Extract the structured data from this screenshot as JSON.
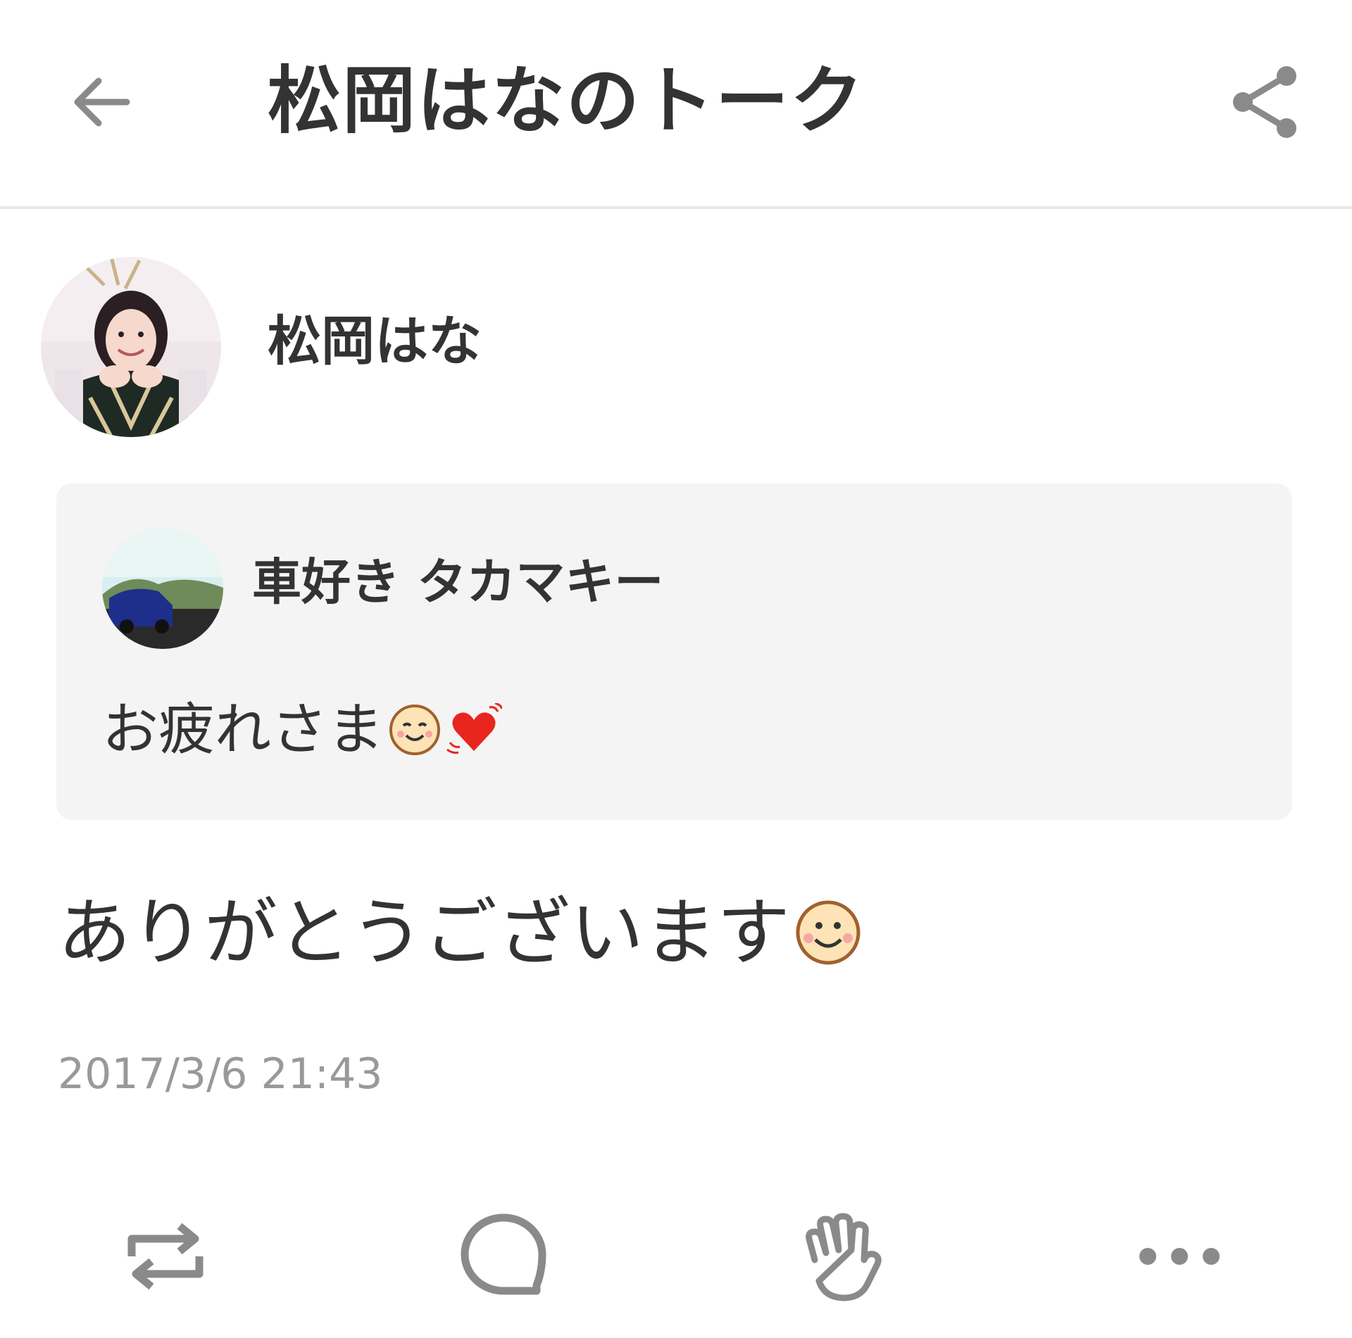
{
  "header": {
    "title": "松岡はなのトーク",
    "back_icon": "arrow-left-icon",
    "share_icon": "share-icon"
  },
  "post": {
    "author_name": "松岡はな",
    "quoted": {
      "author_name": "車好き タカマキー",
      "text": "お疲れさま"
    },
    "text": "ありがとうございます",
    "timestamp": "2017/3/6 21:43"
  },
  "actions": [
    {
      "icon": "repost-icon"
    },
    {
      "icon": "comment-icon"
    },
    {
      "icon": "clap-icon"
    },
    {
      "icon": "more-icon"
    }
  ],
  "colors": {
    "text": "#333333",
    "muted": "#999999",
    "icon": "#8a8a8a",
    "quote_bg": "#f4f4f4"
  }
}
